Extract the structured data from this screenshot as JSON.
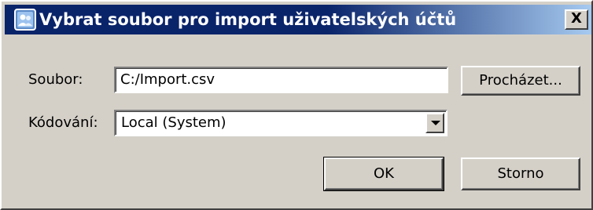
{
  "window": {
    "title": "Vybrat soubor pro import uživatelských účtů",
    "close_label": "X"
  },
  "form": {
    "file_label": "Soubor:",
    "file_value": "C:/Import.csv",
    "browse_label": "Procházet...",
    "encoding_label": "Kódování:",
    "encoding_value": "Local (System)"
  },
  "buttons": {
    "ok_label": "OK",
    "cancel_label": "Storno"
  },
  "colors": {
    "titlebar_start": "#0a246a",
    "titlebar_end": "#a6caf0",
    "face": "#d4d0c8"
  }
}
